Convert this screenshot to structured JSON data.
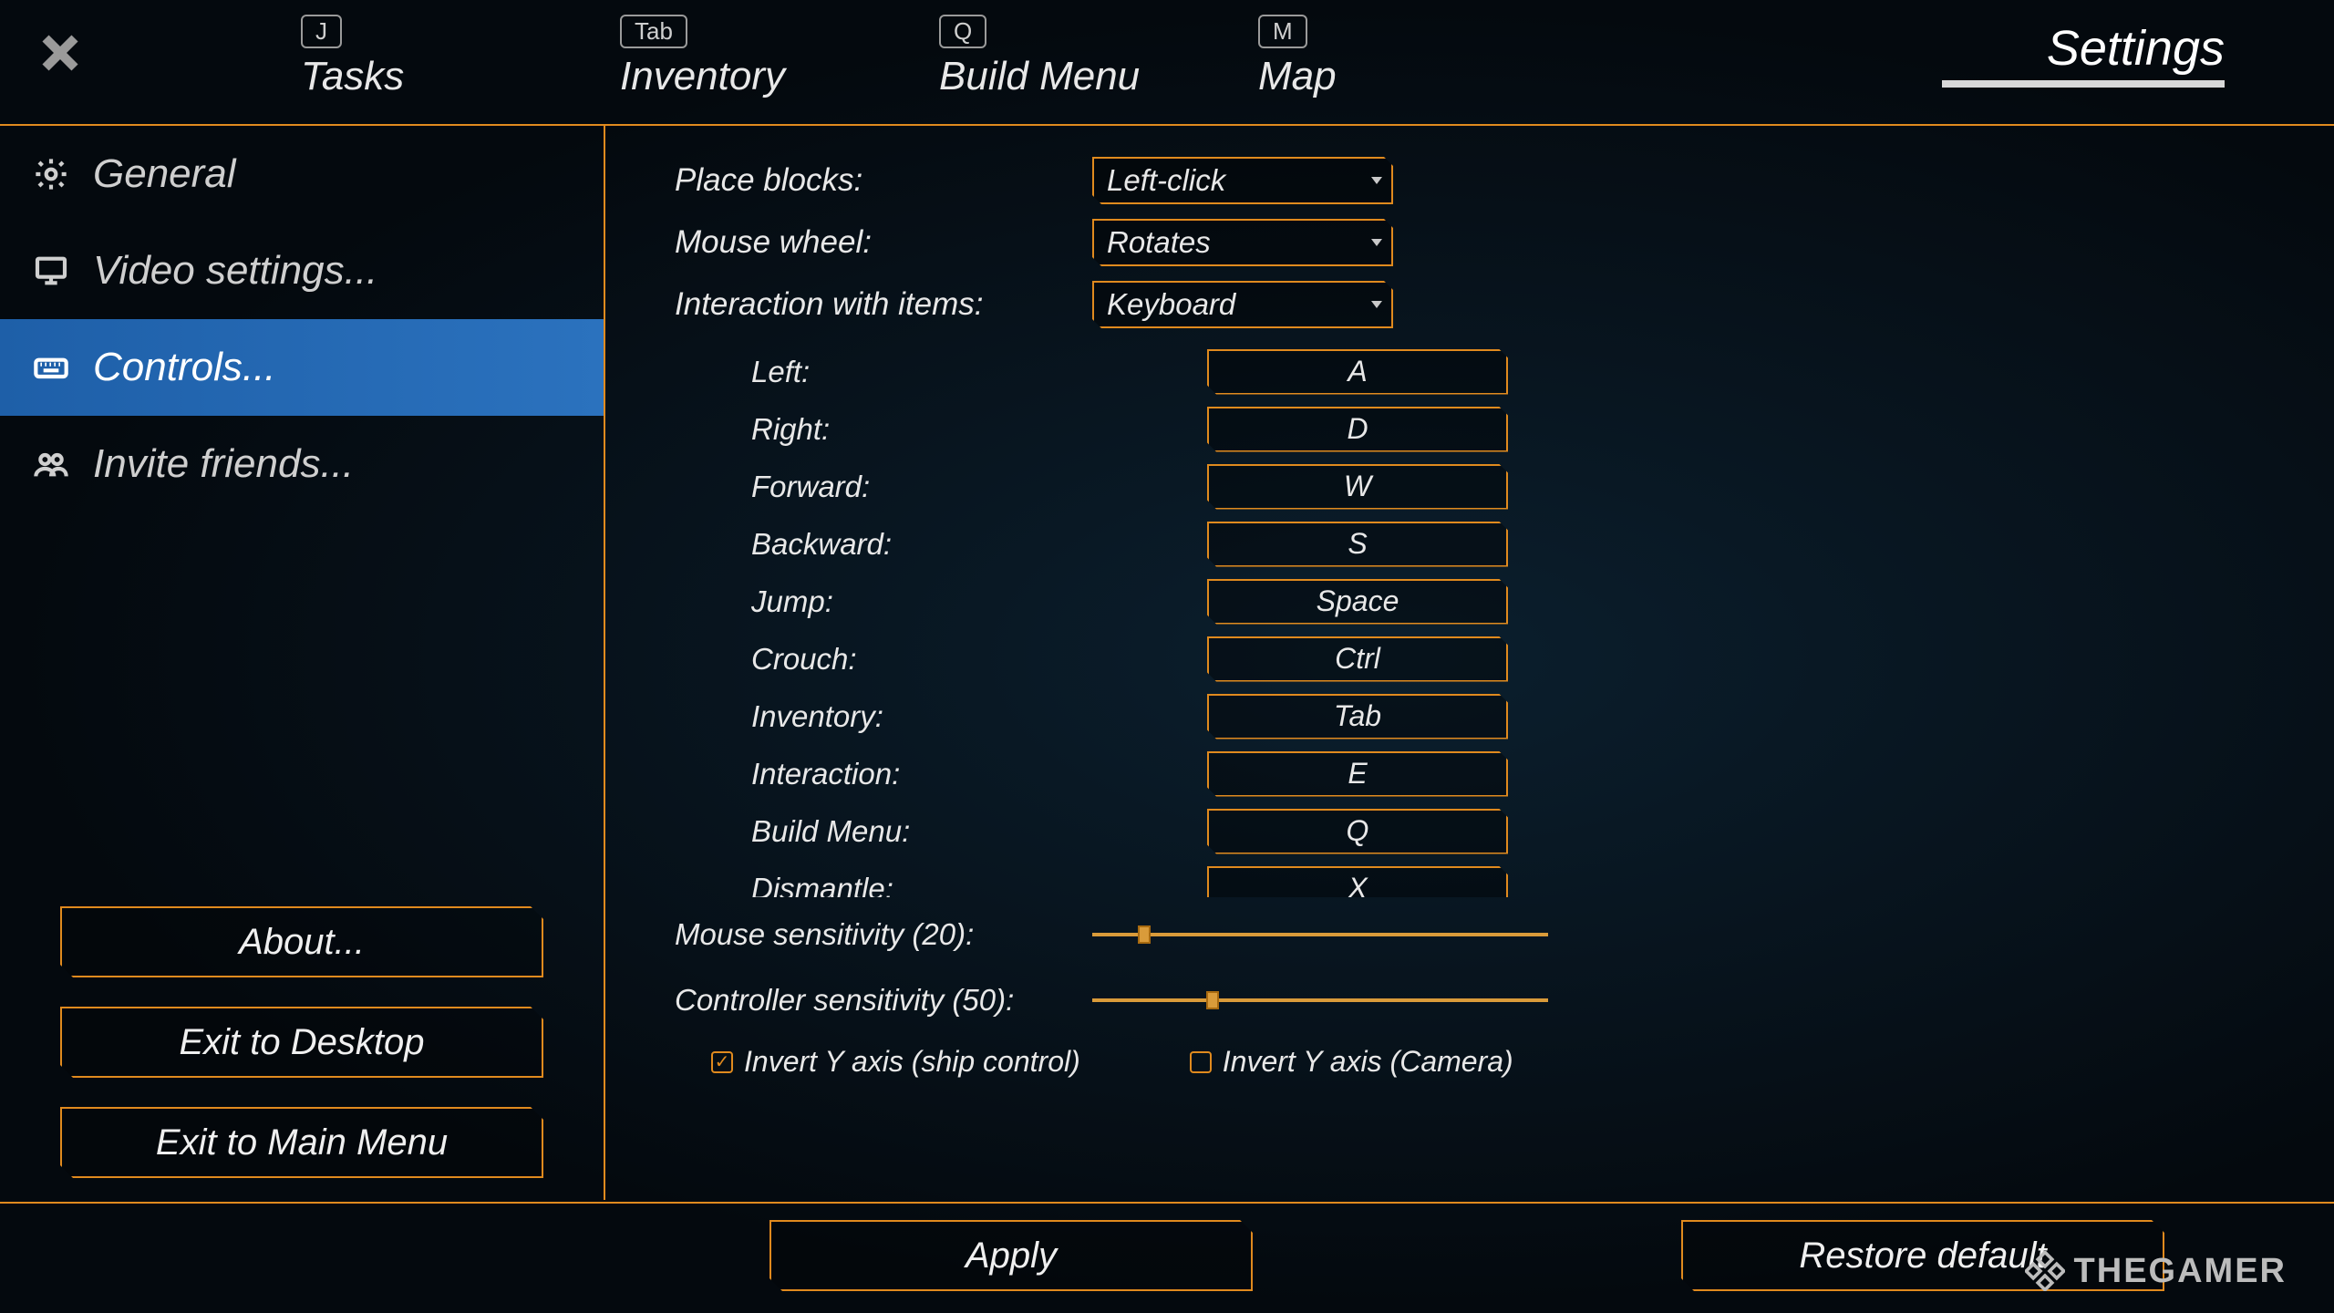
{
  "header": {
    "tabs": [
      {
        "key": "J",
        "label": "Tasks"
      },
      {
        "key": "Tab",
        "label": "Inventory"
      },
      {
        "key": "Q",
        "label": "Build Menu"
      },
      {
        "key": "M",
        "label": "Map"
      }
    ],
    "active_tab": "Settings"
  },
  "sidebar": {
    "items": [
      {
        "icon": "gear",
        "label": "General"
      },
      {
        "icon": "monitor",
        "label": "Video settings..."
      },
      {
        "icon": "keyboard",
        "label": "Controls..."
      },
      {
        "icon": "people",
        "label": "Invite friends..."
      }
    ],
    "active_index": 2,
    "buttons": {
      "about": "About...",
      "exit_desktop": "Exit to Desktop",
      "exit_main": "Exit to Main Menu"
    }
  },
  "controls": {
    "dropdowns": [
      {
        "label": "Place blocks:",
        "value": "Left-click"
      },
      {
        "label": "Mouse wheel:",
        "value": "Rotates"
      },
      {
        "label": "Interaction with items:",
        "value": "Keyboard"
      }
    ],
    "bindings": [
      {
        "label": "Left:",
        "key": "A"
      },
      {
        "label": "Right:",
        "key": "D"
      },
      {
        "label": "Forward:",
        "key": "W"
      },
      {
        "label": "Backward:",
        "key": "S"
      },
      {
        "label": "Jump:",
        "key": "Space"
      },
      {
        "label": "Crouch:",
        "key": "Ctrl"
      },
      {
        "label": "Inventory:",
        "key": "Tab"
      },
      {
        "label": "Interaction:",
        "key": "E"
      },
      {
        "label": "Build Menu:",
        "key": "Q"
      },
      {
        "label": "Dismantle:",
        "key": "X"
      }
    ],
    "sliders": {
      "mouse": {
        "label": "Mouse sensitivity (20):",
        "value": 20,
        "pct": 10
      },
      "controller": {
        "label": "Controller sensitivity (50):",
        "value": 50,
        "pct": 25
      }
    },
    "checkboxes": {
      "invert_ship": {
        "label": "Invert Y axis (ship control)",
        "checked": true
      },
      "invert_camera": {
        "label": "Invert Y axis (Camera)",
        "checked": false
      }
    },
    "buttons": {
      "apply": "Apply",
      "restore": "Restore default"
    }
  },
  "watermark": "THEGAMER"
}
